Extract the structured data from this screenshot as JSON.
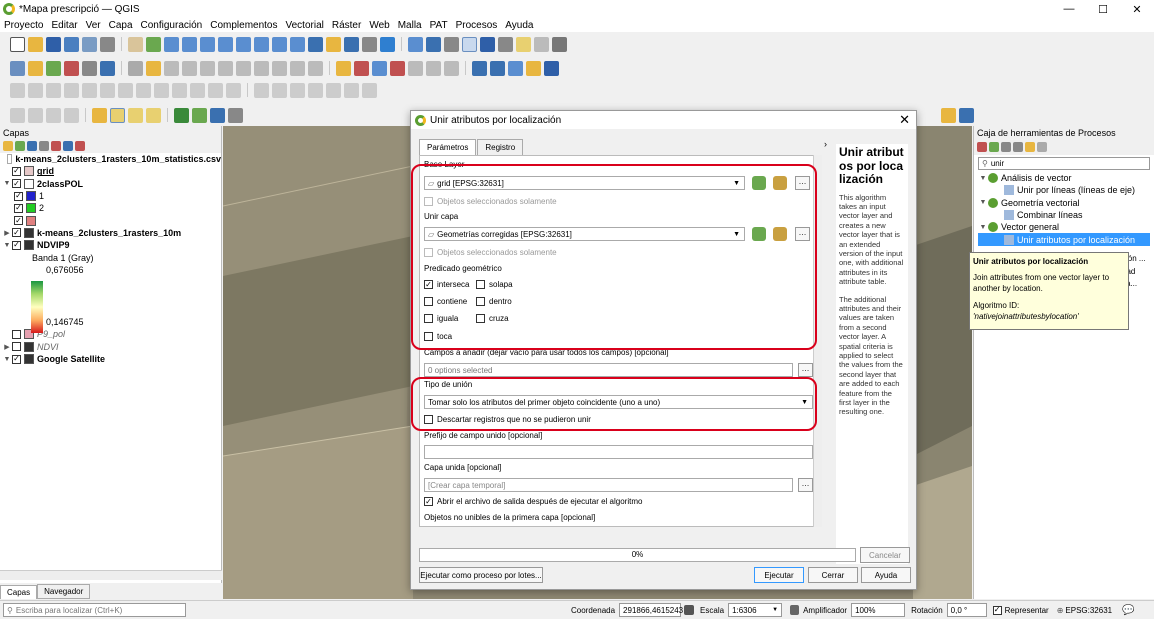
{
  "window": {
    "title": "*Mapa prescripció — QGIS",
    "controls": [
      "—",
      "☐",
      "✕"
    ]
  },
  "menu": [
    "Proyecto",
    "Editar",
    "Ver",
    "Capa",
    "Configuración",
    "Complementos",
    "Vectorial",
    "Ráster",
    "Web",
    "Malla",
    "PAT",
    "Procesos",
    "Ayuda"
  ],
  "layers_panel": {
    "title": "Capas",
    "items": [
      {
        "label": "k-means_2clusters_1rasters_10m_statistics.csv",
        "bold": true
      },
      {
        "label": "grid",
        "bold": true
      },
      {
        "label": "2classPOL",
        "bold": true
      },
      {
        "label": "1",
        "color": "#2222cc"
      },
      {
        "label": "2",
        "color": "#22cc22"
      },
      {
        "label": "",
        "color": "#e08080"
      },
      {
        "label": "k-means_2clusters_1rasters_10m",
        "bold": true
      },
      {
        "label": "NDVIP9",
        "bold": true
      },
      {
        "label": "Banda 1 (Gray)"
      },
      {
        "label": "0,676056"
      },
      {
        "label": "0,146745"
      },
      {
        "label": "P9_pol",
        "italic": true
      },
      {
        "label": "NDVI",
        "italic": true
      },
      {
        "label": "Google Satellite",
        "bold": true
      }
    ],
    "tabs": [
      "Capas",
      "Navegador"
    ]
  },
  "toolbox": {
    "title": "Caja de herramientas de Procesos",
    "search": "unir",
    "tree": [
      {
        "label": "Análisis de vector",
        "level": 0
      },
      {
        "label": "Unir por líneas (líneas de eje)",
        "level": 1
      },
      {
        "label": "Geometría vectorial",
        "level": 0
      },
      {
        "label": "Combinar líneas",
        "level": 1
      },
      {
        "label": "Vector general",
        "level": 0
      },
      {
        "label": "Unir atributos por localización",
        "level": 1
      }
    ],
    "tooltip": {
      "title": "Unir atributos por localización",
      "body": "Join attributes from one vector layer to another by location.",
      "id_label": "Algoritmo ID:",
      "id": "'nativejoinattributesbylocation'",
      "cut_right": [
        "ción ...",
        "dad",
        "ca..."
      ]
    }
  },
  "dialog": {
    "title": "Unir atributos por localización",
    "tabs": [
      "Parámetros",
      "Registro"
    ],
    "base_layer_label": "Base Layer",
    "base_layer_value": "grid [EPSG:32631]",
    "selected_only": "Objetos seleccionados solamente",
    "join_layer_label": "Unir capa",
    "join_layer_value": "Geometrías corregidas [EPSG:32631]",
    "predicate_label": "Predicado geométrico",
    "predicates": [
      {
        "label": "interseca",
        "checked": true
      },
      {
        "label": "solapa",
        "checked": false
      },
      {
        "label": "contiene",
        "checked": false
      },
      {
        "label": "dentro",
        "checked": false
      },
      {
        "label": "iguala",
        "checked": false
      },
      {
        "label": "cruza",
        "checked": false
      },
      {
        "label": "toca",
        "checked": false
      }
    ],
    "fields_label": "Campos a añadir (dejar vacío para usar todos los campos) [opcional]",
    "fields_value": "0 options selected",
    "join_type_label": "Tipo de unión",
    "join_type_value": "Tomar solo los atributos del primer objeto coincidente (uno a uno)",
    "discard_label": "Descartar registros que no se pudieron unir",
    "prefix_label": "Prefijo de campo unido [opcional]",
    "joined_layer_label": "Capa unida [opcional]",
    "joined_layer_placeholder": "[Crear capa temporal]",
    "open_output_label": "Abrir el archivo de salida después de ejecutar el algoritmo",
    "unjoinable_label": "Objetos no unibles de la primera capa [opcional]",
    "progress": "0%",
    "progress_value": 0,
    "cancel": "Cancelar",
    "batch": "Ejecutar como proceso por lotes...",
    "run": "Ejecutar",
    "close": "Cerrar",
    "help": "Ayuda",
    "help_title": "Unir atributos por localización",
    "help_p1": "This algorithm takes an input vector layer and creates a new vector layer that is an extended version of the input one, with additional attributes in its attribute table.",
    "help_p2": "The additional attributes and their values are taken from a second vector layer. A spatial criteria is applied to select the values from the second layer that are added to each feature from the first layer in the resulting one."
  },
  "statusbar": {
    "search_placeholder": "Escriba para localizar (Ctrl+K)",
    "coord_label": "Coordenada",
    "coord": "291866,4615243",
    "scale_label": "Escala",
    "scale": "1:6306",
    "magnifier_label": "Amplificador",
    "magnifier": "100%",
    "rotation_label": "Rotación",
    "rotation": "0,0 °",
    "render_label": "Representar",
    "crs": "EPSG:32631"
  }
}
